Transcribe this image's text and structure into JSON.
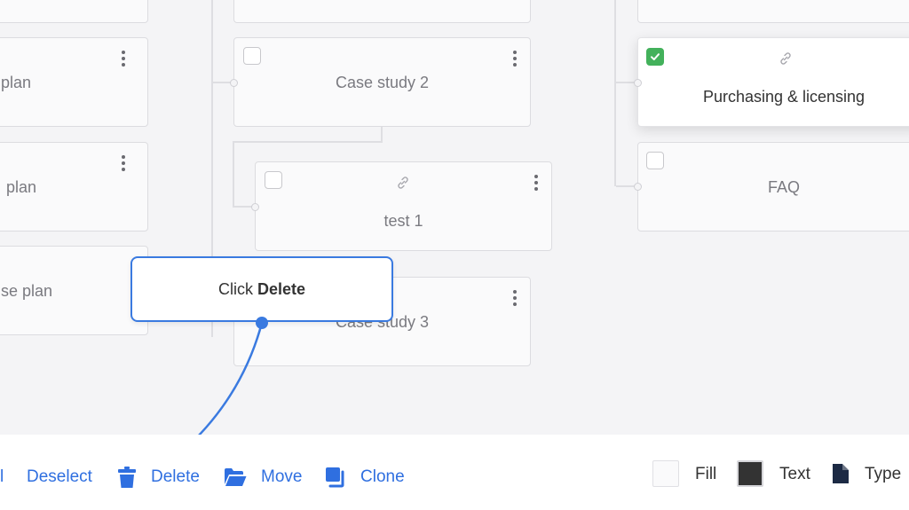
{
  "canvas": {
    "col1": {
      "cards": [
        "plan",
        "plan",
        "se plan"
      ]
    },
    "col2": {
      "cards": [
        "Case study 2",
        "test 1",
        "Case study 3"
      ]
    },
    "col3": {
      "cards": [
        "Purchasing & licensing",
        "FAQ"
      ]
    }
  },
  "tooltip": {
    "prefix": "Click",
    "bold": "Delete"
  },
  "toolbar": {
    "partial_label": "l",
    "deselect": "Deselect",
    "delete": "Delete",
    "move": "Move",
    "clone": "Clone",
    "fill": "Fill",
    "text": "Text",
    "type": "Type"
  },
  "colors": {
    "accent": "#2f6fe0",
    "check": "#43b15b",
    "text_swatch": "#333333"
  },
  "icons": [
    "trash-icon",
    "folder-open-icon",
    "clone-icon",
    "file-icon",
    "link-icon",
    "kebab-icon",
    "check-icon"
  ]
}
